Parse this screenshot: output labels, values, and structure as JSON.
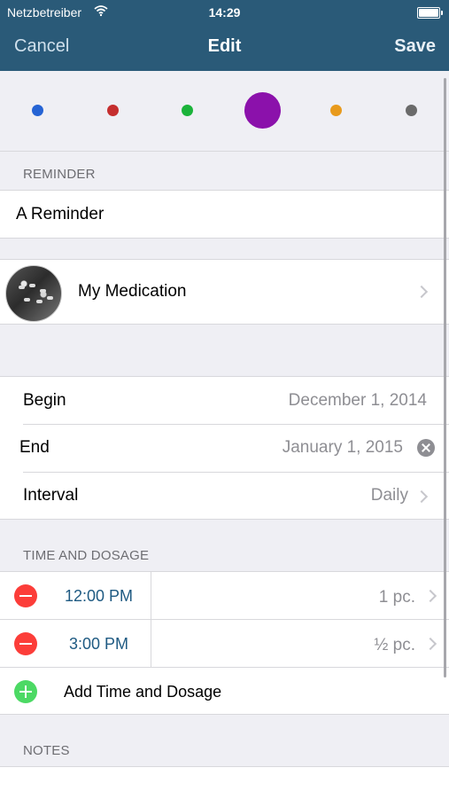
{
  "status_bar": {
    "carrier": "Netzbetreiber",
    "time": "14:29"
  },
  "nav": {
    "cancel": "Cancel",
    "title": "Edit",
    "save": "Save"
  },
  "color_picker": {
    "options": [
      {
        "color": "#2563d4",
        "selected": false
      },
      {
        "color": "#c52e2e",
        "selected": false
      },
      {
        "color": "#1bb33a",
        "selected": false
      },
      {
        "color": "#8b11ab",
        "selected": true
      },
      {
        "color": "#e89a1c",
        "selected": false
      },
      {
        "color": "#6a6a6a",
        "selected": false
      }
    ]
  },
  "reminder": {
    "section_label": "REMINDER",
    "name": "A Reminder"
  },
  "medication": {
    "name": "My Medication"
  },
  "schedule": {
    "begin_label": "Begin",
    "begin_value": "December 1, 2014",
    "end_label": "End",
    "end_value": "January 1, 2015",
    "interval_label": "Interval",
    "interval_value": "Daily"
  },
  "dosage": {
    "section_label": "TIME AND DOSAGE",
    "entries": [
      {
        "time": "12:00 PM",
        "amount": "1 pc."
      },
      {
        "time": "3:00 PM",
        "amount": "½ pc."
      }
    ],
    "add_label": "Add Time and Dosage"
  },
  "notes": {
    "section_label": "NOTES"
  }
}
